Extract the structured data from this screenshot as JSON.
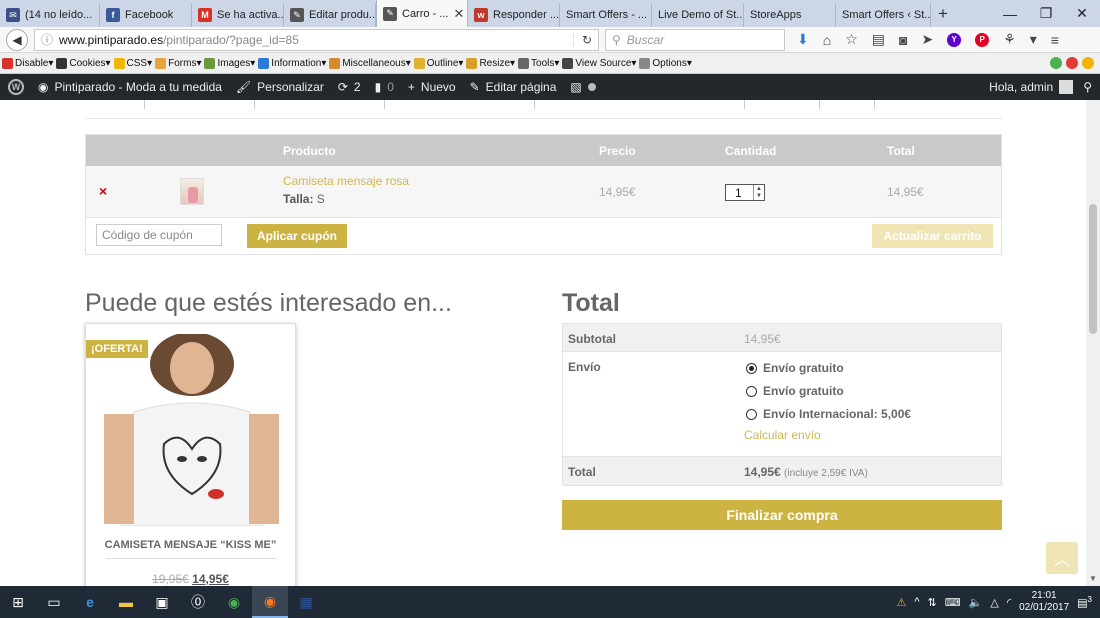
{
  "browser": {
    "tabs": [
      {
        "label": "(14 no leído...",
        "icon": "mail-icon",
        "color": "#3c4f8a",
        "glyph": "✉",
        "w": 100
      },
      {
        "label": "Facebook",
        "icon": "facebook-icon",
        "color": "#3b5998",
        "glyph": "f",
        "w": 92
      },
      {
        "label": "Se ha activa...",
        "icon": "gmail-icon",
        "color": "#d93025",
        "glyph": "M",
        "w": 92
      },
      {
        "label": "Editar produ...",
        "icon": "feather-icon",
        "color": "#555555",
        "glyph": "✎",
        "w": 92
      },
      {
        "label": "Carro - ...",
        "icon": "feather-icon",
        "color": "#555555",
        "glyph": "✎",
        "w": 92,
        "active": true
      },
      {
        "label": "Responder ...",
        "icon": "responder-icon",
        "color": "#c0392b",
        "glyph": "w",
        "w": 92
      },
      {
        "label": "Smart Offers - ...",
        "icon": "",
        "color": "",
        "glyph": "",
        "w": 92
      },
      {
        "label": "Live Demo of St...",
        "icon": "",
        "color": "",
        "glyph": "",
        "w": 92
      },
      {
        "label": "StoreApps",
        "icon": "",
        "color": "",
        "glyph": "",
        "w": 92
      },
      {
        "label": "Smart Offers ‹ St...",
        "icon": "",
        "color": "",
        "glyph": "",
        "w": 95
      }
    ],
    "url_domain": "www.pintiparado.es",
    "url_path": "/pintiparado/?page_id=85",
    "search_placeholder": "Buscar"
  },
  "devtoolbar": {
    "items": [
      {
        "label": "Disable▾",
        "color": "#d9342b"
      },
      {
        "label": "Cookies▾",
        "color": "#333333"
      },
      {
        "label": "CSS▾",
        "color": "#f2b705"
      },
      {
        "label": "Forms▾",
        "color": "#e8a33d"
      },
      {
        "label": "Images▾",
        "color": "#6a9a3a"
      },
      {
        "label": "Information▾",
        "color": "#2b7bd6"
      },
      {
        "label": "Miscellaneous▾",
        "color": "#d68a2b"
      },
      {
        "label": "Outline▾",
        "color": "#e0b030"
      },
      {
        "label": "Resize▾",
        "color": "#d6a02b"
      },
      {
        "label": "Tools▾",
        "color": "#666666"
      },
      {
        "label": "View Source▾",
        "color": "#444444"
      },
      {
        "label": "Options▾",
        "color": "#888888"
      }
    ]
  },
  "adminbar": {
    "site": "Pintiparado - Moda a tu medida",
    "customize": "Personalizar",
    "updates": "2",
    "comments": "0",
    "new": "Nuevo",
    "edit": "Editar página",
    "greeting": "Hola, admin"
  },
  "cart": {
    "headers": {
      "product": "Producto",
      "price": "Precio",
      "qty": "Cantidad",
      "total": "Total"
    },
    "item": {
      "remove": "×",
      "name": "Camiseta mensaje rosa",
      "size_label": "Talla:",
      "size_value": "S",
      "price": "14,95€",
      "qty": "1",
      "total": "14,95€"
    },
    "coupon_placeholder": "Código de cupón",
    "apply_coupon": "Aplicar cupón",
    "update_cart": "Actualizar carrito"
  },
  "related": {
    "title": "Puede que estés interesado en...",
    "product": {
      "badge": "¡OFERTA!",
      "name": "CAMISETA MENSAJE “KISS ME”",
      "old_price": "19,95€",
      "price": "14,95€"
    }
  },
  "totals": {
    "title": "Total",
    "subtotal_label": "Subtotal",
    "subtotal_value": "14,95€",
    "shipping_label": "Envío",
    "shipping_options": [
      {
        "label": "Envío gratuito",
        "selected": true
      },
      {
        "label": "Envío gratuito",
        "selected": false
      },
      {
        "label": "Envío Internacional: 5,00€",
        "selected": false
      }
    ],
    "calc_shipping": "Calcular envío",
    "total_label": "Total",
    "total_value": "14,95€",
    "total_tax_note": "(incluye 2,59€ IVA)",
    "checkout": "Finalizar compra"
  },
  "taskbar": {
    "time": "21:01",
    "date": "02/01/2017",
    "notifications": "3"
  }
}
